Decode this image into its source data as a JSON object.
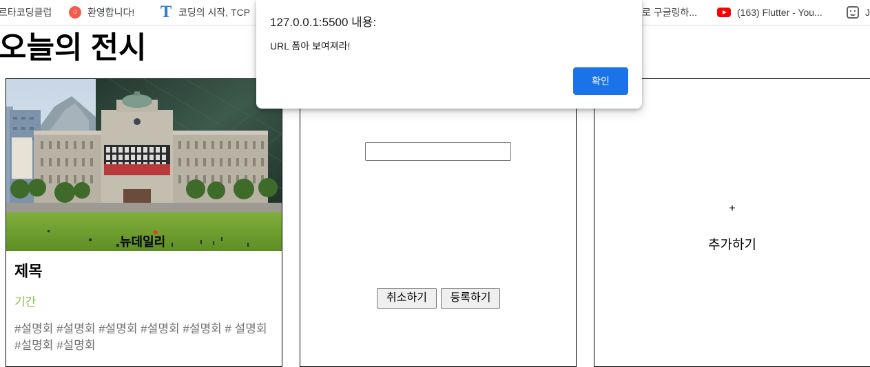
{
  "bookmarks": [
    {
      "label": "르타코딩클럽",
      "icon": "none"
    },
    {
      "label": "환영합니다!",
      "icon": "red-dot-icon"
    },
    {
      "label": "코딩의 시작, TCP",
      "icon": "t-logo-icon"
    },
    {
      "label": "로 구글링하...",
      "icon": "none"
    },
    {
      "label": "(163) Flutter - You...",
      "icon": "youtube-icon"
    },
    {
      "label": "J",
      "icon": "face-icon"
    }
  ],
  "page": {
    "title": "오늘의 전시"
  },
  "card": {
    "title": "제목",
    "period": "기간",
    "tags": "#설명회 #설명회 #설명회 #설명회 #설명회 # 설명회 #설명회 #설명회",
    "watermark": "뉴데일리"
  },
  "form": {
    "url_value": "",
    "cancel_label": "취소하기",
    "submit_label": "등록하기"
  },
  "add_card": {
    "plus": "+",
    "label": "추가하기"
  },
  "dialog": {
    "title": "127.0.0.1:5500 내용:",
    "message": "URL 폼아 보여져라!",
    "ok_label": "확인"
  },
  "colors": {
    "period": "#8bc34a",
    "tags": "#707070",
    "ok_button": "#1a73e8"
  }
}
